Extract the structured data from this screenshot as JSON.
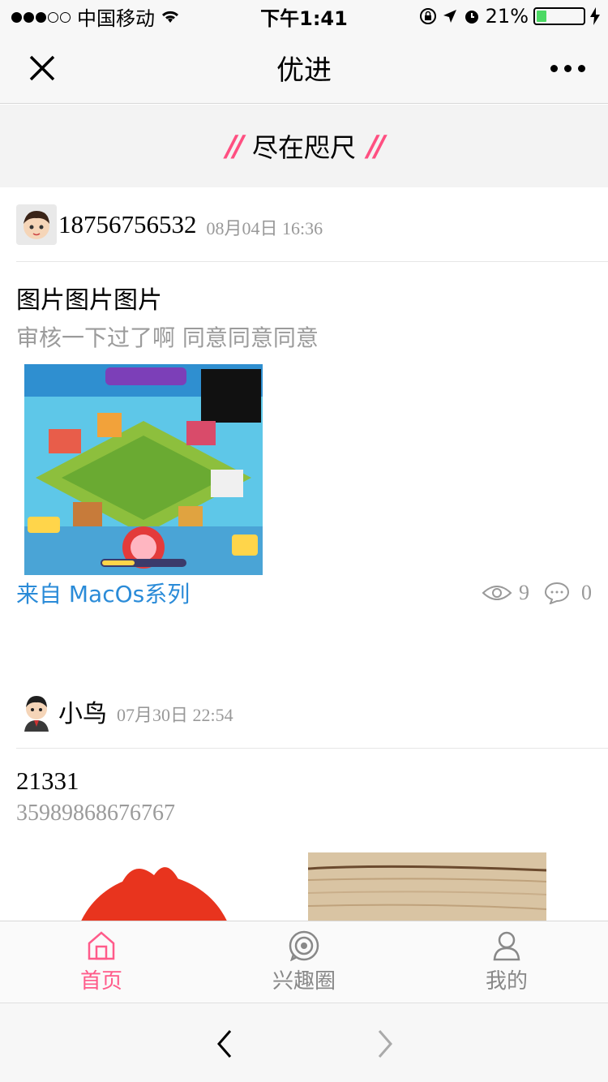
{
  "status_bar": {
    "carrier": "中国移动",
    "time": "下午1:41",
    "battery_percent": "21%",
    "battery_level": 0.21
  },
  "navbar": {
    "title": "优进"
  },
  "banner": {
    "text": "尽在咫尺",
    "accent_color": "#ff4f81"
  },
  "posts": [
    {
      "username": "18756756532",
      "time": "08月04日 16:36",
      "title": "图片图片图片",
      "description": "审核一下过了啊 同意同意同意",
      "source": "来自 MacOs系列",
      "views": "9",
      "comments": "0"
    },
    {
      "username": "小鸟",
      "time": "07月30日 22:54",
      "title": "21331",
      "description": "35989868676767"
    }
  ],
  "tabbar": {
    "items": [
      {
        "label": "首页",
        "icon": "home-icon",
        "active": true
      },
      {
        "label": "兴趣圈",
        "icon": "interest-circle-icon",
        "active": false
      },
      {
        "label": "我的",
        "icon": "user-icon",
        "active": false
      }
    ],
    "active_color": "#ff5b8a"
  }
}
